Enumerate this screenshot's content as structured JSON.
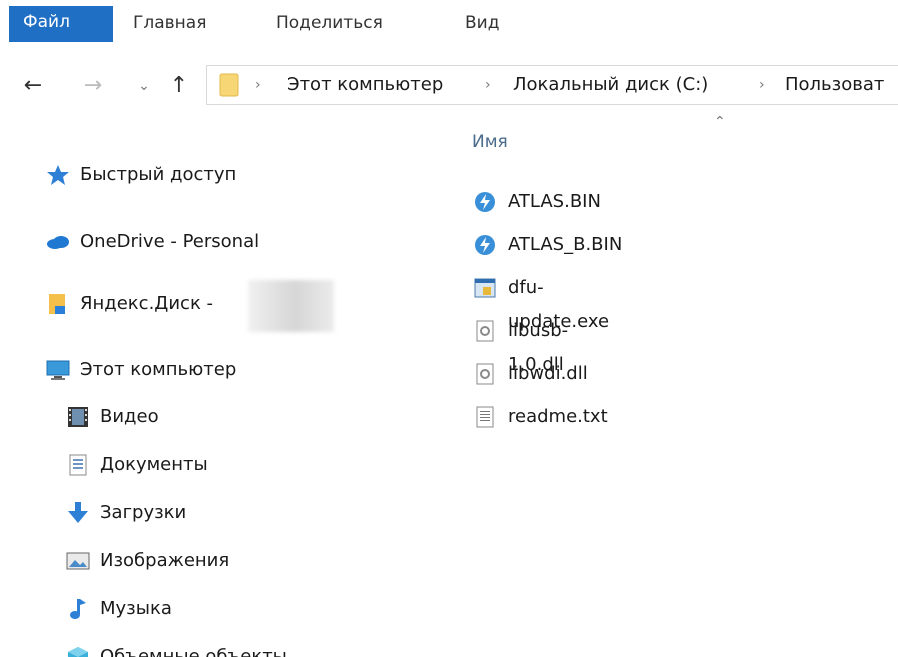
{
  "ribbon": {
    "tabs": [
      "Файл",
      "Главная",
      "Поделиться",
      "Вид"
    ],
    "active_color": "#1f6fc5"
  },
  "nav": {
    "back_icon": "arrow-left-icon",
    "forward_icon": "arrow-right-icon",
    "recent_icon": "chevron-down-icon",
    "up_icon": "arrow-up-icon",
    "breadcrumb": [
      "Этот компьютер",
      "Локальный диск (C:)",
      "Пользоват"
    ]
  },
  "sidebar": {
    "items": [
      {
        "label": "Быстрый доступ",
        "icon": "star-icon"
      },
      {
        "label": "OneDrive - Personal",
        "icon": "cloud-icon"
      },
      {
        "label": "Яндекс.Диск -",
        "icon": "yandex-disk-icon"
      },
      {
        "label": "Этот компьютер",
        "icon": "computer-icon"
      },
      {
        "label": "Видео",
        "icon": "video-icon"
      },
      {
        "label": "Документы",
        "icon": "documents-icon"
      },
      {
        "label": "Загрузки",
        "icon": "downloads-icon"
      },
      {
        "label": "Изображения",
        "icon": "pictures-icon"
      },
      {
        "label": "Музыка",
        "icon": "music-icon"
      },
      {
        "label": "Объемные объекты",
        "icon": "3d-objects-icon"
      }
    ]
  },
  "files": {
    "column_name": "Имя",
    "items": [
      {
        "name": "ATLAS.BIN",
        "icon": "bin-file-icon"
      },
      {
        "name": "ATLAS_B.BIN",
        "icon": "bin-file-icon"
      },
      {
        "name": "dfu-update.exe",
        "icon": "exe-file-icon"
      },
      {
        "name": "libusb-1.0.dll",
        "icon": "dll-file-icon"
      },
      {
        "name": "libwdi.dll",
        "icon": "dll-file-icon"
      },
      {
        "name": "readme.txt",
        "icon": "txt-file-icon"
      }
    ]
  }
}
